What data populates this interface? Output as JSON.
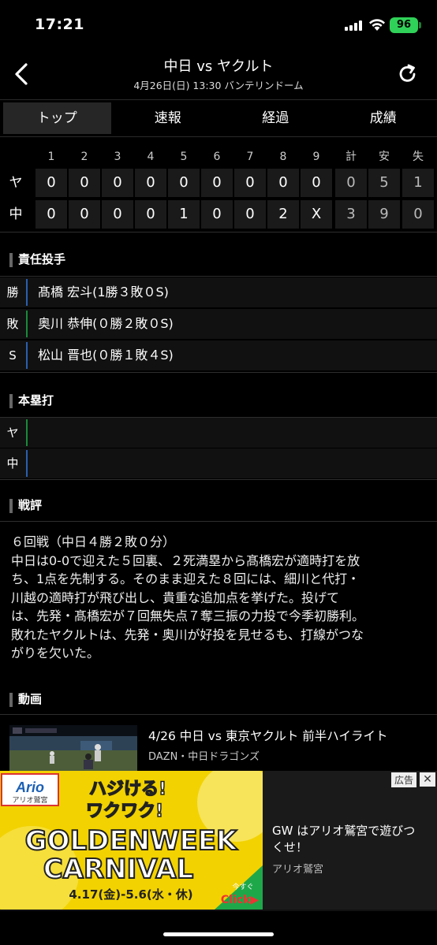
{
  "status": {
    "time": "17:21",
    "battery": "96"
  },
  "header": {
    "title": "中日 vs ヤクルト",
    "subtitle": "4月26日(日) 13:30 バンテリンドーム"
  },
  "tabs": [
    "トップ",
    "速報",
    "経過",
    "成績"
  ],
  "scoreboard": {
    "headers": [
      "1",
      "2",
      "3",
      "4",
      "5",
      "6",
      "7",
      "8",
      "9",
      "計",
      "安",
      "失"
    ],
    "teams": [
      {
        "name": "ヤ",
        "cells": [
          "0",
          "0",
          "0",
          "0",
          "0",
          "0",
          "0",
          "0",
          "0",
          "0",
          "5",
          "1"
        ]
      },
      {
        "name": "中",
        "cells": [
          "0",
          "0",
          "0",
          "0",
          "1",
          "0",
          "0",
          "2",
          "X",
          "3",
          "9",
          "0"
        ]
      }
    ]
  },
  "pitchers": {
    "heading": "責任投手",
    "rows": [
      {
        "tag": "勝",
        "text": "髙橋 宏斗(1勝３敗０S)"
      },
      {
        "tag": "敗",
        "text": "奥川 恭伸(０勝２敗０S)"
      },
      {
        "tag": "S",
        "text": "松山 晋也(０勝１敗４S)"
      }
    ]
  },
  "homeruns": {
    "heading": "本塁打",
    "rows": [
      {
        "tag": "ヤ",
        "text": ""
      },
      {
        "tag": "中",
        "text": ""
      }
    ]
  },
  "review": {
    "heading": "戦評",
    "lines": [
      "６回戦（中日４勝２敗０分）",
      "中日は0-0で迎えた５回裏、２死満塁から髙橋宏が適時打を放",
      "ち、1点を先制する。そのまま迎えた８回には、細川と代打・",
      "川越の適時打が飛び出し、貴重な追加点を挙げた。投げて",
      "は、先発・髙橋宏が７回無失点７奪三振の力投で今季初勝利。",
      "敗れたヤクルトは、先発・奥川が好投を見せるも、打線がつな",
      "がりを欠いた。"
    ]
  },
  "video": {
    "heading": "動画",
    "title": "4/26 中日 vs 東京ヤクルト 前半ハイライト",
    "source": "DAZN・中日ドラゴンズ"
  },
  "ad": {
    "badge": "広告",
    "close": "✕",
    "logo": "Ario",
    "logo_sub": "アリオ鷲宮",
    "tagline1": "ハジける!",
    "tagline2": "ワクワク!",
    "banner1": "GOLDENWEEK",
    "banner2": "CARNIVAL",
    "dates": "4.17(金)-5.6(水・休)",
    "cta_small": "今すぐ",
    "cta": "Click▶",
    "title": "GW はアリオ鷲宮で遊びつくせ！",
    "brand": "アリオ鷲宮"
  },
  "colors": {
    "accent_green": "#1a8a3a",
    "accent_blue": "#2a5fb0",
    "ad_yellow": "#f2d200"
  }
}
